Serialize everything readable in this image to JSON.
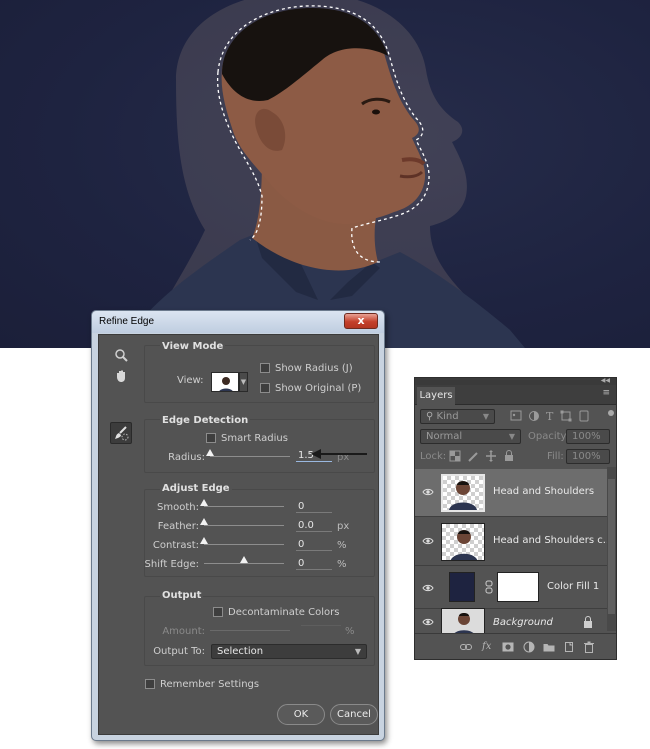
{
  "refine_edge": {
    "title": "Refine Edge",
    "close_label": "x",
    "view_mode": {
      "heading": "View Mode",
      "view_label": "View:",
      "show_radius": "Show Radius (J)",
      "show_original": "Show Original (P)"
    },
    "edge_detection": {
      "heading": "Edge Detection",
      "smart_radius": "Smart Radius",
      "radius_label": "Radius:",
      "radius_value": "1.5",
      "radius_unit": "px"
    },
    "adjust_edge": {
      "heading": "Adjust Edge",
      "smooth_label": "Smooth:",
      "smooth_value": "0",
      "feather_label": "Feather:",
      "feather_value": "0.0",
      "feather_unit": "px",
      "contrast_label": "Contrast:",
      "contrast_value": "0",
      "contrast_unit": "%",
      "shift_label": "Shift Edge:",
      "shift_value": "0",
      "shift_unit": "%"
    },
    "output": {
      "heading": "Output",
      "decontaminate": "Decontaminate Colors",
      "amount_label": "Amount:",
      "amount_unit": "%",
      "output_to_label": "Output To:",
      "output_to_value": "Selection"
    },
    "remember_settings": "Remember Settings",
    "ok_label": "OK",
    "cancel_label": "Cancel"
  },
  "layers_panel": {
    "tab": "Layers",
    "kind_label": "Kind",
    "blend_mode": "Normal",
    "opacity_label": "Opacity:",
    "opacity_value": "100%",
    "lock_label": "Lock:",
    "fill_label": "Fill:",
    "fill_value": "100%",
    "layers": [
      {
        "name": "Head and Shoulders"
      },
      {
        "name": "Head and Shoulders c..."
      },
      {
        "name": "Color Fill 1"
      },
      {
        "name": "Background"
      }
    ]
  },
  "colors": {
    "canvas_bg": "#1e2340",
    "panel_bg": "#535353",
    "dialog_frame": "#c8d3e0",
    "close_button": "#c4402b"
  }
}
